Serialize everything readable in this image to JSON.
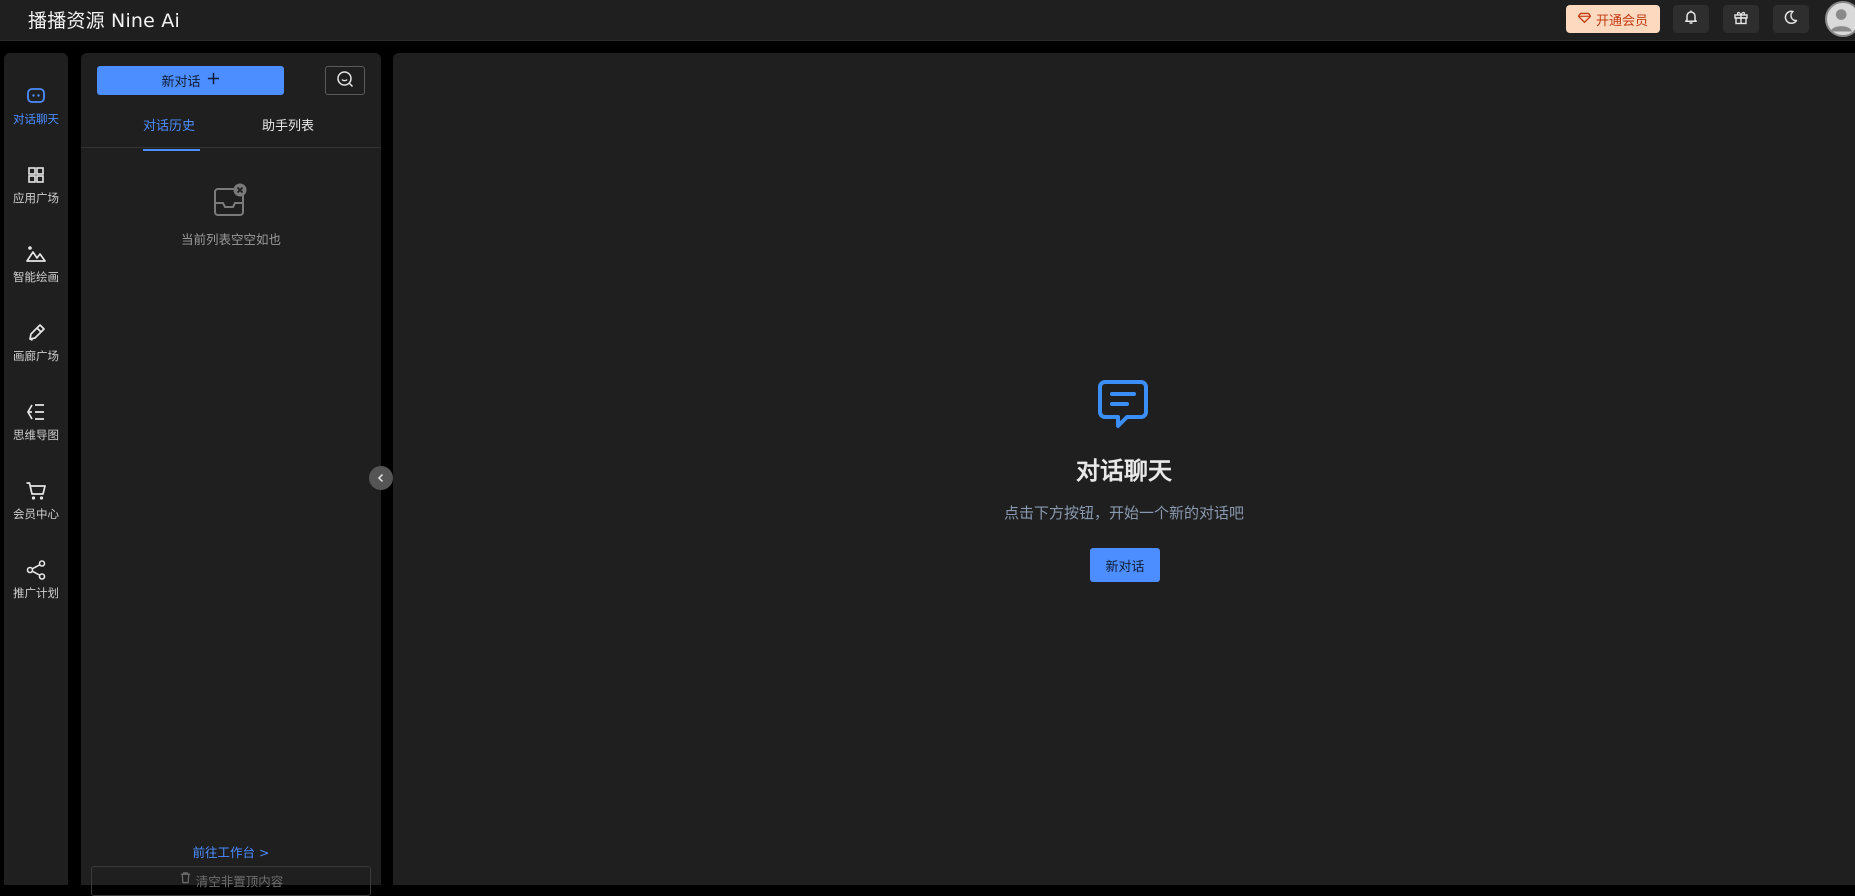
{
  "header": {
    "brand": "播播资源 Nine Ai",
    "vip_label": "开通会员",
    "icons": [
      "bell-icon",
      "gift-icon",
      "moon-icon",
      "avatar"
    ]
  },
  "sidebar": {
    "items": [
      {
        "label": "对话聊天",
        "icon": "chat-icon",
        "active": true
      },
      {
        "label": "应用广场",
        "icon": "grid-icon",
        "active": false
      },
      {
        "label": "智能绘画",
        "icon": "mountain-icon",
        "active": false
      },
      {
        "label": "画廊广场",
        "icon": "brush-icon",
        "active": false
      },
      {
        "label": "思维导图",
        "icon": "mindmap-icon",
        "active": false
      },
      {
        "label": "会员中心",
        "icon": "cart-icon",
        "active": false
      },
      {
        "label": "推广计划",
        "icon": "share-icon",
        "active": false
      }
    ]
  },
  "panel": {
    "new_chat_label": "新对话",
    "tabs": [
      "对话历史",
      "助手列表"
    ],
    "active_tab": "对话历史",
    "empty_text": "当前列表空空如也",
    "workbench_link": "前往工作台 >",
    "clear_label": "清空非置顶内容"
  },
  "main": {
    "title": "对话聊天",
    "subtitle": "点击下方按钮，开始一个新的对话吧",
    "button_label": "新对话"
  },
  "colors": {
    "accent": "#4c8dff",
    "vip_bg": "#fcd9bf",
    "vip_text": "#c23b12",
    "panel_bg": "#1f1f1f"
  }
}
